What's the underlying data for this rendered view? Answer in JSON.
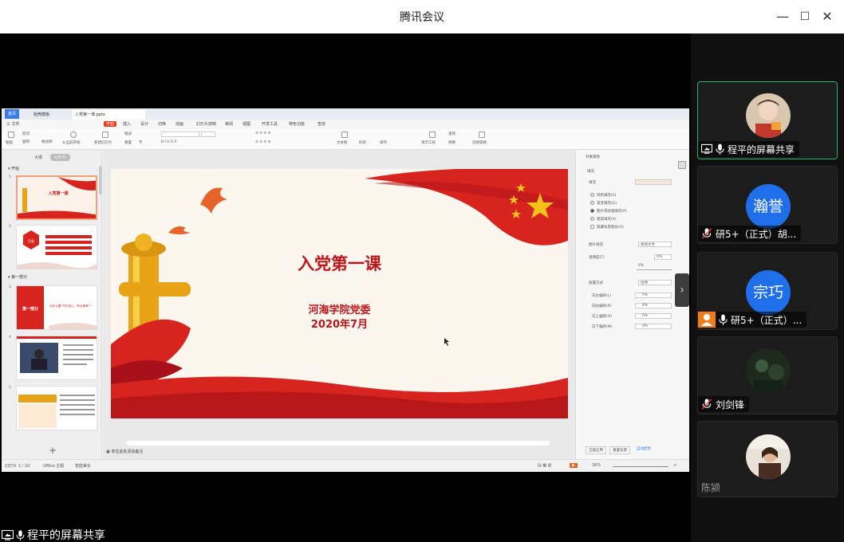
{
  "window": {
    "title": "腾讯会议",
    "minimize_icon": "—",
    "maximize_icon": "☐",
    "close_icon": "✕"
  },
  "share": {
    "label": "程平的屏幕共享",
    "expand_icon": "›"
  },
  "wps": {
    "tabs": [
      "首页",
      "稻壳模板",
      "入党第一课.pptx"
    ],
    "menu": [
      "三 文件",
      "开始",
      "插入",
      "设计",
      "切换",
      "动画",
      "幻灯片放映",
      "审阅",
      "视图",
      "开发工具",
      "特色功能",
      "查找"
    ],
    "ribbon_labels": [
      "粘贴",
      "剪切",
      "复制",
      "格式刷",
      "从当前开始",
      "新建幻灯片",
      "版式",
      "重置",
      "节",
      "文本框",
      "形状",
      "排列",
      "演示工具",
      "查找",
      "替换",
      "选择窗格"
    ],
    "pane_tabs": [
      "大纲",
      "幻灯片"
    ],
    "sections": [
      "开始",
      "第一部分"
    ],
    "thumb_numbers": [
      "1",
      "2",
      "3",
      "4",
      "5"
    ],
    "thumb_texts": [
      "入党第一课",
      "目录",
      "第一部分",
      "为什么要“不忘初心、牢记使命”？"
    ],
    "slide": {
      "title": "入党第一课",
      "org": "河海学院党委",
      "date": "2020年7月"
    },
    "notes_placeholder": "单击此处添加备注",
    "props": {
      "header": "对象属性",
      "tab": "填充",
      "fill_label": "填充",
      "options": [
        "纯色填充(S)",
        "渐变填充(G)",
        "图片或纹理填充(P)",
        "图案填充(A)",
        "隐藏背景图形(H)"
      ],
      "fields": [
        "图片填充",
        "透明度(T)",
        "放置方式",
        "向左偏移(L)",
        "向右偏移(R)",
        "向上偏移(O)",
        "向下偏移(M)"
      ],
      "values": [
        "本地文件",
        "0%",
        "0%",
        "拉伸",
        "0%",
        "0%",
        "0%",
        "0%"
      ],
      "footer": [
        "全部应用",
        "重置背景",
        "自动配色"
      ]
    },
    "status": {
      "slide_no": "幻灯片 1 / 10",
      "theme": "Office 主题",
      "smart": "智能美化",
      "zoom": "39%"
    }
  },
  "participants": [
    {
      "name": "程平的屏幕共享",
      "avatar_type": "photo",
      "mic": "on",
      "share": true,
      "active": true
    },
    {
      "name": "研5+（正式）胡...",
      "avatar_type": "text",
      "avatar_text": "瀚誉",
      "mic": "muted"
    },
    {
      "name": "研5+（正式）...",
      "avatar_type": "text",
      "avatar_text": "宗巧",
      "mic": "on",
      "host": true
    },
    {
      "name": "刘剑锋",
      "avatar_type": "photo",
      "mic": "muted"
    },
    {
      "name": "陈颍",
      "avatar_type": "photo",
      "mic": "none"
    }
  ],
  "colors": {
    "accent_green": "#2db26e",
    "avatar_blue": "#1f6feb",
    "slide_red": "#c0141b",
    "wps_orange": "#e83c1c"
  }
}
